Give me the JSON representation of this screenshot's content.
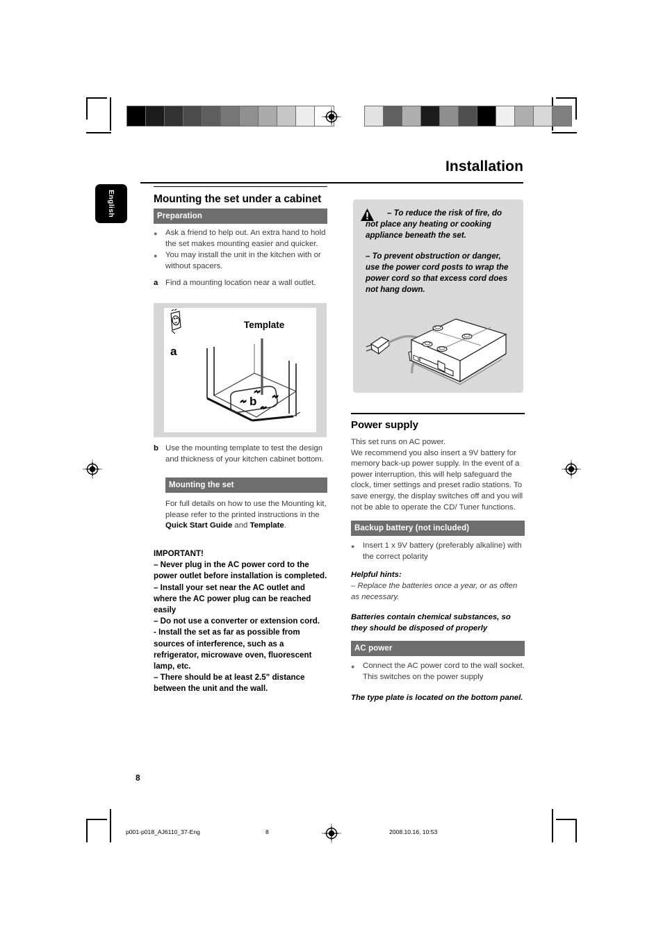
{
  "header": {
    "title": "Installation",
    "language_tab": "English"
  },
  "left_column": {
    "section_title": "Mounting the set under a cabinet",
    "preparation_bar": "Preparation",
    "preparation_bullets": [
      "Ask a friend to help out. An extra hand to hold the set makes mounting easier and quicker.",
      "You may install the unit in the kitchen with or without spacers."
    ],
    "step_a_letter": "a",
    "step_a_text": "Find a mounting location near a wall outlet.",
    "figure": {
      "label_template": "Template",
      "label_a": "a",
      "label_b": "b"
    },
    "step_b_letter": "b",
    "step_b_text": "Use the mounting template to test the design and thickness of your kitchen cabinet bottom.",
    "mounting_bar": "Mounting the set",
    "mounting_text_1": "For full details on how to use the Mounting kit, please refer to the printed instructions in the ",
    "mounting_bold_1": "Quick Start Guide",
    "mounting_text_2": " and ",
    "mounting_bold_2": "Template",
    "mounting_text_3": ".",
    "important_heading": "IMPORTANT!",
    "important_lines": [
      "–   Never plug in the AC power cord to the power outlet before installation is completed.",
      "–   Install your set near the AC outlet and where the AC power plug can be reached easily",
      "–   Do not use a converter or extension cord.",
      " - Install the set as far as possible from sources of interference, such as a refrigerator, microwave oven, fluorescent lamp, etc.",
      "–   There should be at least 2.5\" distance between the unit and the wall."
    ]
  },
  "right_column": {
    "warning": {
      "icon": "warning-triangle-icon",
      "paragraph_1": "–  To reduce the risk of fire, do not place any heating or cooking appliance beneath the set.",
      "paragraph_2": " –  To prevent obstruction or danger, use the power cord posts to wrap the power cord so that excess cord does not hang down.",
      "illustration": "appliance-bottom-panel-with-power-cord-illustration"
    },
    "power_supply_title": "Power supply",
    "power_supply_text": "This set runs on AC power.\nWe recommend you also insert a 9V battery for memory back-up power supply. In the event of a power interruption, this will help safeguard the clock, timer settings and preset radio stations. To save energy, the display switches off and you will not be able to operate the CD/ Tuner functions.",
    "backup_bar": "Backup battery (not included)",
    "backup_bullet": "Insert 1 x 9V battery (preferably alkaline) with the correct polarity",
    "helpful_hints_heading": "Helpful hints:",
    "helpful_hints_text": "–   Replace the batteries once a year, or as often as necessary.",
    "batteries_note": "Batteries contain chemical substances, so they should be disposed of properly",
    "ac_power_bar": "AC power",
    "ac_power_bullet": "Connect the AC power cord to the wall socket. This switches on the power supply",
    "type_plate_note": "The type plate is located on the bottom panel."
  },
  "page_number": "8",
  "footer": {
    "file_name": "p001-p018_AJ6110_37-Eng",
    "page": "8",
    "timestamp": "2008.10.16, 10:53"
  },
  "calibration": {
    "left_strip": [
      "#000000",
      "#1c1c1c",
      "#333333",
      "#4c4c4c",
      "#5e5e5e",
      "#777777",
      "#909090",
      "#aaaaaa",
      "#c6c6c6",
      "#ededed",
      "#ffffff"
    ],
    "right_strip": [
      "#e2e2e2",
      "#606060",
      "#aeaeae",
      "#1c1c1c",
      "#8e8e8e",
      "#4f4f4f",
      "#000000",
      "#f0f0f0",
      "#aeaeae",
      "#d8d8d8",
      "#808080"
    ]
  }
}
